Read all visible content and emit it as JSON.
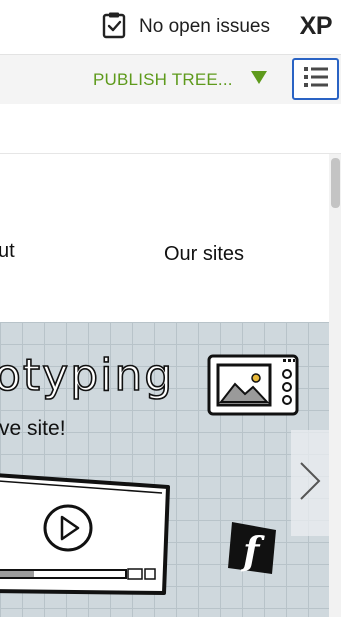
{
  "status": {
    "issues_label": "No open issues",
    "issues_icon": "clipboard-check-icon",
    "app_badge": "XP"
  },
  "toolbar": {
    "publish_label": "PUBLISH TREE...",
    "publish_color": "#5e9a1c",
    "dropdown_icon": "triangle-down-icon",
    "menu_icon": "list-icon",
    "menu_border_color": "#2a63c4"
  },
  "preview": {
    "nav": {
      "about": "ut",
      "sites": "Our sites"
    },
    "hero": {
      "headline": "otyping",
      "subtitle": "ve site!"
    },
    "icons": [
      "image-frame-icon",
      "play-icon",
      "facebook-icon",
      "chevron-right-icon"
    ]
  }
}
